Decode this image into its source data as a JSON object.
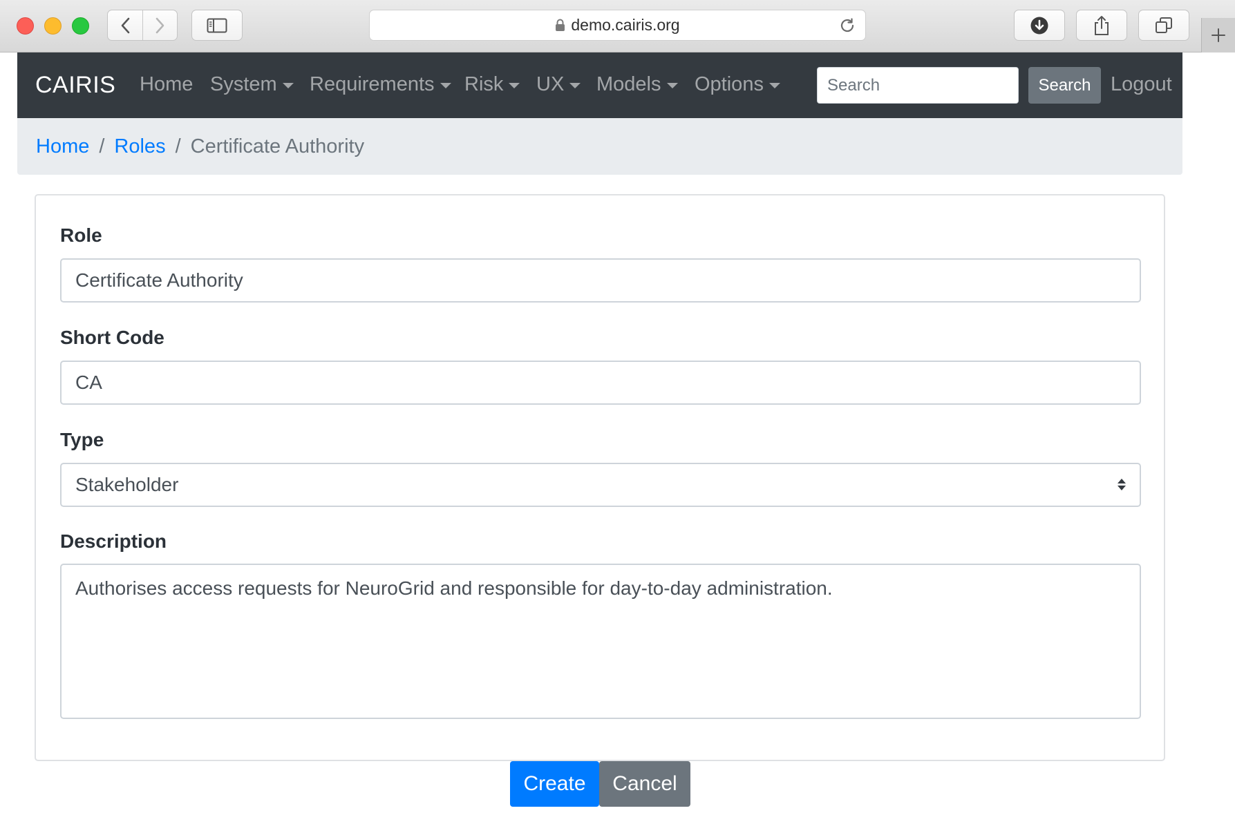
{
  "browser": {
    "url": "demo.cairis.org"
  },
  "navbar": {
    "brand": "CAIRIS",
    "items": [
      {
        "label": "Home",
        "dropdown": false
      },
      {
        "label": "System",
        "dropdown": true
      },
      {
        "label": "Requirements",
        "dropdown": true
      },
      {
        "label": "Risk",
        "dropdown": true
      },
      {
        "label": "UX",
        "dropdown": true
      },
      {
        "label": "Models",
        "dropdown": true
      },
      {
        "label": "Options",
        "dropdown": true
      }
    ],
    "search_placeholder": "Search",
    "search_button": "Search",
    "logout": "Logout"
  },
  "breadcrumb": {
    "items": [
      "Home",
      "Roles"
    ],
    "separator": "/",
    "active": "Certificate Authority"
  },
  "form": {
    "role_label": "Role",
    "role_value": "Certificate Authority",
    "shortcode_label": "Short Code",
    "shortcode_value": "CA",
    "type_label": "Type",
    "type_value": "Stakeholder",
    "description_label": "Description",
    "description_value": "Authorises access requests for NeuroGrid and responsible for day-to-day administration."
  },
  "buttons": {
    "create": "Create",
    "cancel": "Cancel"
  },
  "colors": {
    "navbar_bg": "#343a40",
    "breadcrumb_bg": "#e9ecef",
    "primary": "#007bff",
    "secondary": "#6c757d"
  },
  "icons": {
    "back": "chevron-left-icon",
    "forward": "chevron-right-icon",
    "sidebar": "sidebar-icon",
    "lock": "lock-icon",
    "reload": "reload-icon",
    "download": "download-icon",
    "share": "share-icon",
    "tabs": "tabs-icon",
    "new_tab": "plus-icon",
    "select": "select-arrows-icon"
  }
}
